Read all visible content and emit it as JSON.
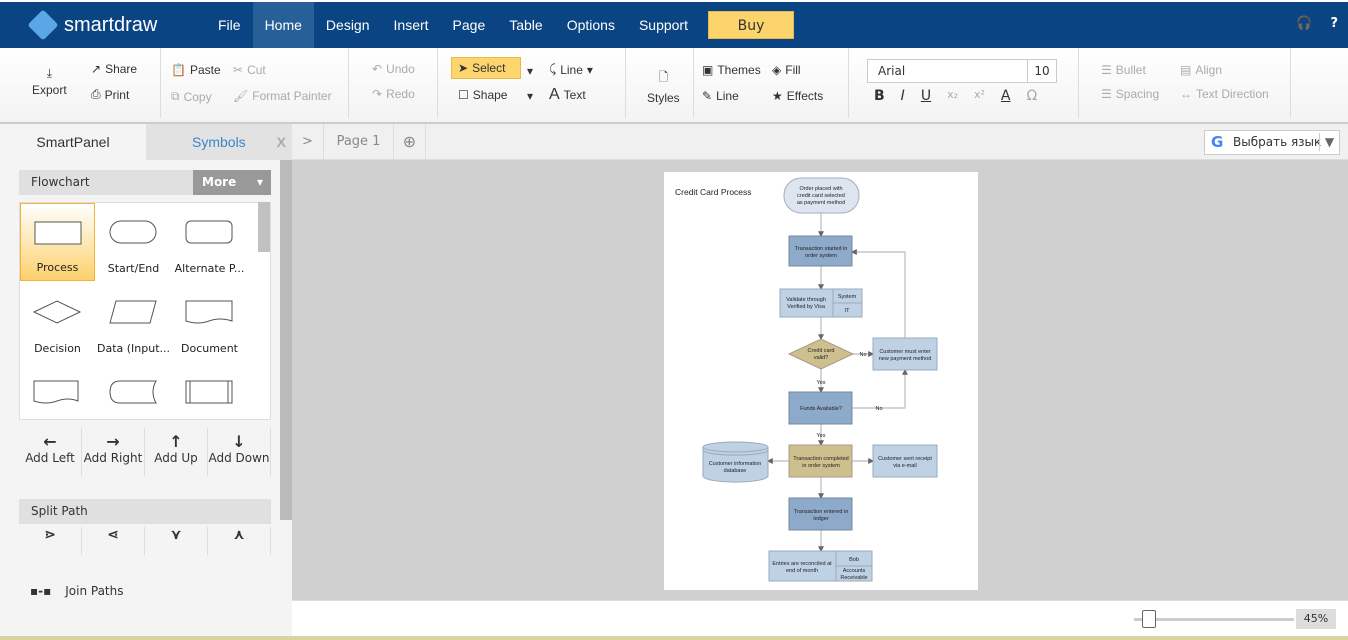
{
  "app": {
    "logo": "smartdraw",
    "menu": [
      "File",
      "Home",
      "Design",
      "Insert",
      "Page",
      "Table",
      "Options",
      "Support"
    ],
    "active_menu": "Home",
    "buy": "Buy"
  },
  "ribbon": {
    "export": "Export",
    "share": "Share",
    "print": "Print",
    "paste": "Paste",
    "cut": "Cut",
    "copy": "Copy",
    "format_painter": "Format Painter",
    "undo": "Undo",
    "redo": "Redo",
    "select": "Select",
    "line": "Line",
    "shape": "Shape",
    "text": "Text",
    "styles": "Styles",
    "themes": "Themes",
    "fill": "Fill",
    "line2": "Line",
    "effects": "Effects",
    "font": "Arial",
    "size": "10",
    "bullet": "Bullet",
    "align": "Align",
    "spacing": "Spacing",
    "text_direction": "Text Direction"
  },
  "panel": {
    "tab_smart": "SmartPanel",
    "tab_symbols": "Symbols",
    "close": "X",
    "library": "Flowchart",
    "more": "More",
    "shapes": [
      "Process",
      "Start/End",
      "Alternate P...",
      "Decision",
      "Data (Input...",
      "Document"
    ],
    "add": [
      "Add Left",
      "Add Right",
      "Add Up",
      "Add Down"
    ],
    "split": "Split Path",
    "join": "Join Paths"
  },
  "tabs": {
    "expand": ">",
    "page": "Page 1",
    "add": "⊕",
    "lang": "Выбрать язык"
  },
  "zoom": {
    "label": "45%",
    "value": 45
  },
  "diagram": {
    "title": "Credit Card Process",
    "start": [
      "Order placed with",
      "credit card selected",
      "as payment method"
    ],
    "started": [
      "Transaction started in",
      "order system"
    ],
    "validate": [
      "Validate through",
      "Verified by Visa"
    ],
    "validate_role": "System",
    "validate_dept": "IT",
    "decision": [
      "Credit card",
      "valid?"
    ],
    "no": "No",
    "yes": "Yes",
    "must_enter": [
      "Customer must enter",
      "new payment method"
    ],
    "funds": "Funds Available?",
    "completed": [
      "Transaction completed",
      "in order system"
    ],
    "database": [
      "Customer information",
      "database"
    ],
    "receipt": [
      "Customer sent receipt",
      "via e-mail"
    ],
    "ledger": [
      "Transaction entered in",
      "ledger"
    ],
    "entries": [
      "Entries are reconciled at",
      "end of month"
    ],
    "entries_role": "Bob",
    "entries_dept": [
      "Accounts",
      "Receivable"
    ],
    "colors": {
      "process": "#8eaacb",
      "light": "#bfd1e5",
      "tan": "#cdbf8e",
      "start": "#dde5f0"
    }
  }
}
